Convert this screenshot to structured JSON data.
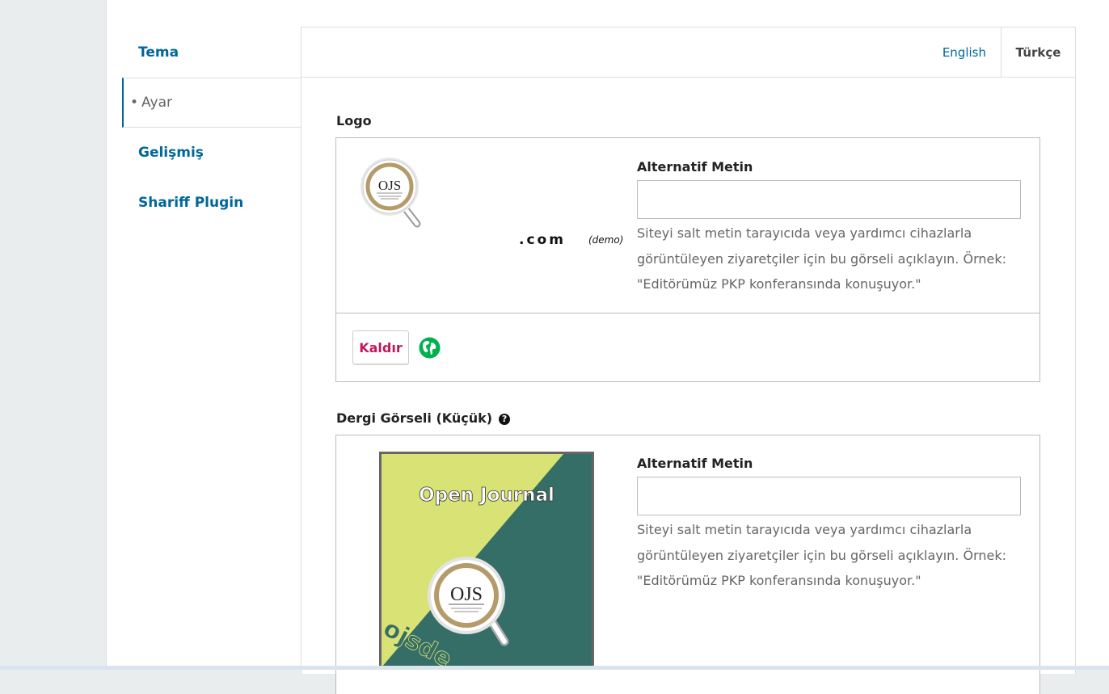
{
  "tabs": [
    {
      "label": "Tema"
    },
    {
      "label": "Ayar",
      "active": true
    },
    {
      "label": "Gelişmiş"
    },
    {
      "label": "Shariff Plugin"
    }
  ],
  "tabs_bullet": "•",
  "languages": {
    "english": "English",
    "turkish": "Türkçe"
  },
  "logo_section": {
    "title": "Logo",
    "logo_image": {
      "badge_text": "OJS",
      "dotcom": ".com",
      "demo": "(demo)"
    },
    "alt_text_label": "Alternatif Metin",
    "alt_text_value": "",
    "help_text": "Siteyi salt metin tarayıcıda veya yardımcı cihazlarla görüntüleyen ziyaretçiler için bu görseli açıklayın. Örnek: \"Editörümüz PKP konferansında konuşuyor.\"",
    "remove_label": "Kaldır",
    "globe_icon": "globe-icon"
  },
  "thumbnail_section": {
    "title": "Dergi Görseli (Küçük)",
    "help_icon": "question-circle-icon",
    "help_icon_glyph": "?",
    "cover_image": {
      "heading": "Open Journal",
      "badge_text": "OJS",
      "corner_text": "ojsde"
    },
    "alt_text_label": "Alternatif Metin",
    "alt_text_value": "",
    "help_text": "Siteyi salt metin tarayıcıda veya yardımcı cihazlarla görüntüleyen ziyaretçiler için bu görseli açıklayın. Örnek: \"Editörümüz PKP konferansında konuşuyor.\""
  },
  "colors": {
    "link": "#006798",
    "remove": "#c0185c",
    "cover_green": "#d9e274",
    "cover_teal": "#356e66",
    "logo_gold": "#b59a6a"
  }
}
